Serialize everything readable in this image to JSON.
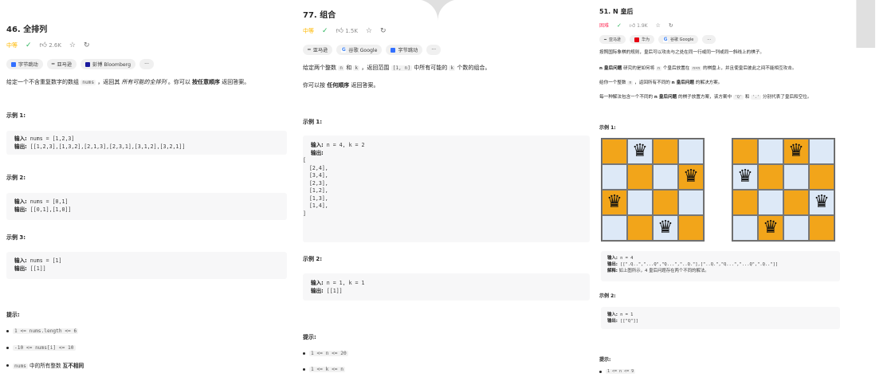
{
  "p1": {
    "title": "46. 全排列",
    "difficulty": "中等",
    "likes": "2.6K",
    "tags": [
      "字节跳动",
      "亚马逊",
      "彭博 Bloomberg",
      "···"
    ],
    "desc_a": "给定一个不含重复数字的数组 ",
    "desc_code": "nums",
    "desc_b": " ，返回其 ",
    "desc_em": "所有可能的全排列",
    "desc_c": " 。你可以 ",
    "desc_strong": "按任意顺序",
    "desc_d": " 返回答案。",
    "ex1_title": "示例 1:",
    "ex1_in_label": "输入:",
    "ex1_in": " nums = [1,2,3]",
    "ex1_out_label": "输出:",
    "ex1_out": " [[1,2,3],[1,3,2],[2,1,3],[2,3,1],[3,1,2],[3,2,1]]",
    "ex2_title": "示例 2:",
    "ex2_in_label": "输入:",
    "ex2_in": " nums = [0,1]",
    "ex2_out_label": "输出:",
    "ex2_out": " [[0,1],[1,0]]",
    "ex3_title": "示例 3:",
    "ex3_in_label": "输入:",
    "ex3_in": " nums = [1]",
    "ex3_out_label": "输出:",
    "ex3_out": " [[1]]",
    "hint_title": "提示:",
    "hint1": "1 <= nums.length <= 6",
    "hint2": "-10 <= nums[i] <= 10",
    "hint3_code": "nums",
    "hint3_a": " 中的所有整数 ",
    "hint3_strong": "互不相同"
  },
  "p2": {
    "title": "77. 组合",
    "difficulty": "中等",
    "likes": "1.5K",
    "tags": [
      "亚马逊",
      "谷歌 Google",
      "字节跳动",
      "···"
    ],
    "desc_a": "给定两个整数 ",
    "desc_n": "n",
    "desc_b": " 和 ",
    "desc_k": "k",
    "desc_c": " ，返回范围 ",
    "desc_range": "[1, n]",
    "desc_d": " 中所有可能的 ",
    "desc_k2": "k",
    "desc_e": " 个数的组合。",
    "desc2_a": "你可以按 ",
    "desc2_strong": "任何顺序",
    "desc2_b": " 返回答案。",
    "ex1_title": "示例 1:",
    "ex1_in_label": "输入:",
    "ex1_in": " n = 4, k = 2",
    "ex1_out_label": "输出:",
    "ex1_out": "[\n  [2,4],\n  [3,4],\n  [2,3],\n  [1,2],\n  [1,3],\n  [1,4],\n]",
    "ex2_title": "示例 2:",
    "ex2_in_label": "输入:",
    "ex2_in": " n = 1, k = 1",
    "ex2_out_label": "输出:",
    "ex2_out": " [[1]]",
    "hint_title": "提示:",
    "hint1": "1 <= n <= 20",
    "hint2": "1 <= k <= n"
  },
  "p3": {
    "title": "51. N 皇后",
    "difficulty": "困难",
    "likes": "1.9K",
    "tags": [
      "亚马逊",
      "华为",
      "谷歌 Google",
      "···"
    ],
    "desc1": "按照国际象棋的规则，皇后可以攻击与之处在同一行或同一列或同一斜线上的棋子。",
    "desc2_strong": "n 皇后问题",
    "desc2_a": " 研究的是如何将 ",
    "desc2_code": "n",
    "desc2_b": " 个皇后放置在 ",
    "desc2_code2": "n×n",
    "desc2_c": " 的棋盘上，并且使皇后彼此之间不能相互攻击。",
    "desc3_a": "给你一个整数 ",
    "desc3_code": "n",
    "desc3_b": " ，返回所有不同的 ",
    "desc3_strong": "n 皇后问题",
    "desc3_c": " 的解决方案。",
    "desc4_a": "每一种解法包含一个不同的 ",
    "desc4_strong": "n 皇后问题",
    "desc4_b": " 的棋子放置方案，该方案中 ",
    "desc4_q": "'Q'",
    "desc4_c": " 和 ",
    "desc4_dot": "'.'",
    "desc4_d": " 分别代表了皇后和空位。",
    "ex1_title": "示例 1:",
    "ex1_in_label": "输入:",
    "ex1_in": " n = 4",
    "ex1_out_label": "输出:",
    "ex1_out": " [[\".Q..\",\"...Q\",\"Q...\",\"..Q.\"],[\"..Q.\",\"Q...\",\"...Q\",\".Q..\"]]",
    "ex1_expl_label": "解释:",
    "ex1_expl": " 如上图所示，4 皇后问题存在两个不同的解法。",
    "ex2_title": "示例 2:",
    "ex2_in_label": "输入:",
    "ex2_in": " n = 1",
    "ex2_out_label": "输出:",
    "ex2_out": " [[\"Q\"]]",
    "hint_title": "提示:",
    "hint1": "1 <= n <= 9"
  }
}
